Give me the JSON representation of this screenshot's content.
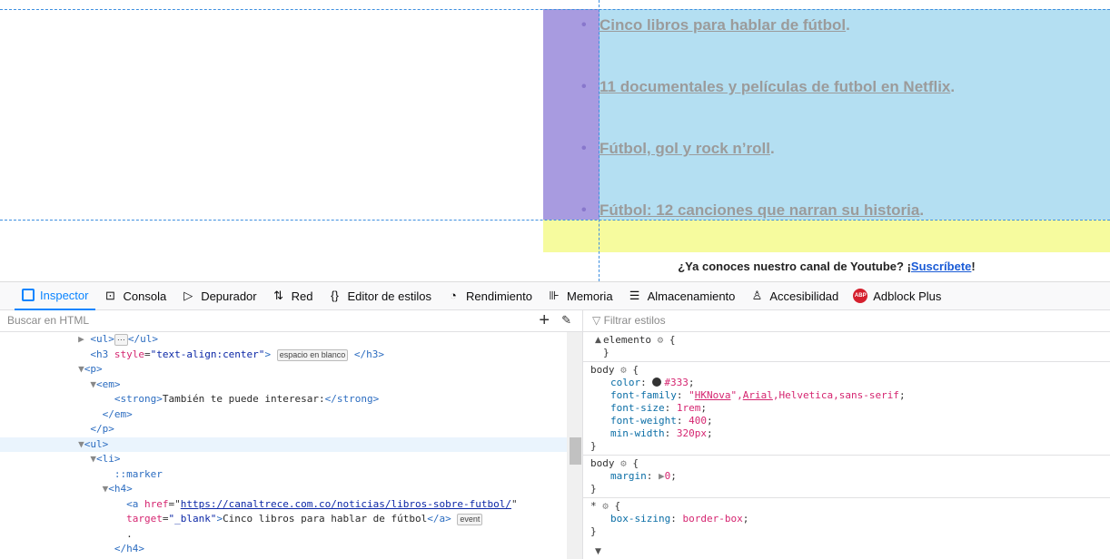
{
  "page": {
    "links": [
      {
        "text": "Cinco libros para hablar de fútbol"
      },
      {
        "text": "11 documentales y películas de futbol en Netflix"
      },
      {
        "text": "Fútbol, gol y rock n’roll"
      },
      {
        "text": "Fútbol: 12 canciones que narran su historia"
      }
    ],
    "link_suffix": ".",
    "youtube_text": "¿Ya conoces nuestro canal de Youtube? ¡",
    "youtube_link": "Suscríbete",
    "youtube_suffix": "!"
  },
  "toolbar": {
    "tabs": [
      {
        "label": "Inspector",
        "icon": "inspector-icon"
      },
      {
        "label": "Consola",
        "icon": "console-icon"
      },
      {
        "label": "Depurador",
        "icon": "debugger-icon"
      },
      {
        "label": "Red",
        "icon": "network-icon"
      },
      {
        "label": "Editor de estilos",
        "icon": "style-editor-icon"
      },
      {
        "label": "Rendimiento",
        "icon": "performance-icon"
      },
      {
        "label": "Memoria",
        "icon": "memory-icon"
      },
      {
        "label": "Almacenamiento",
        "icon": "storage-icon"
      },
      {
        "label": "Accesibilidad",
        "icon": "accessibility-icon"
      },
      {
        "label": "Adblock Plus",
        "icon": "adblock-icon"
      }
    ],
    "active_color": "#0a84ff"
  },
  "search": {
    "html_placeholder": "Buscar en HTML",
    "styles_placeholder": "Filtrar estilos"
  },
  "markup": {
    "ul_collapsed": "ul",
    "h3_style_attr": "style",
    "h3_style_val": "\"text-align:center\"",
    "whitespace_badge": "espacio en blanco",
    "strong_text": "También te puede interesar:",
    "marker": "::marker",
    "href_attr": "href",
    "href_val": "https://canaltrece.com.co/noticias/libros-sobre-futbol/",
    "target_attr": "target",
    "target_val": "\"_blank\"",
    "a_text": "Cinco libros para hablar de fútbol",
    "event_badge": "event",
    "dot_text": "."
  },
  "rules": {
    "element_selector": "elemento",
    "body1": {
      "selector": "body",
      "color_prop": "color",
      "color_val": "#333",
      "font_family_prop": "font-family",
      "font_family_q": "\"",
      "font_family_1": "HKNova",
      "font_family_2": "Arial",
      "font_family_rest": ",Helvetica,sans-serif",
      "font_size_prop": "font-size",
      "font_size_val": "1rem",
      "font_weight_prop": "font-weight",
      "font_weight_val": "400",
      "min_width_prop": "min-width",
      "min_width_val": "320px"
    },
    "body2": {
      "selector": "body",
      "margin_prop": "margin",
      "margin_val": "0"
    },
    "star": {
      "selector": "*",
      "box_sizing_prop": "box-sizing",
      "box_sizing_val": "border-box"
    }
  }
}
